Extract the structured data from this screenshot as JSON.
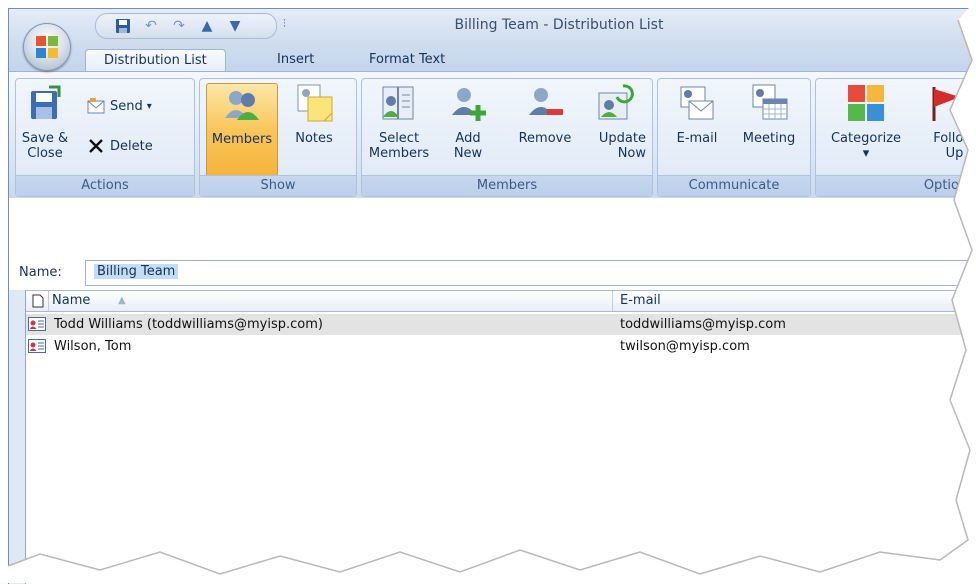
{
  "window": {
    "title": "Billing Team - Distribution List"
  },
  "quick_access": {
    "buttons": [
      "save-icon",
      "undo-icon",
      "redo-icon",
      "previous-item-icon",
      "next-item-icon"
    ],
    "more_symbol": "⫶"
  },
  "tabs": [
    {
      "label": "Distribution List",
      "active": true
    },
    {
      "label": "Insert",
      "active": false
    },
    {
      "label": "Format Text",
      "active": false
    }
  ],
  "ribbon": {
    "actions": {
      "group_label": "Actions",
      "save_close": "Save &\nClose",
      "send": "Send",
      "send_arrow": "▾",
      "delete": "Delete"
    },
    "show": {
      "group_label": "Show",
      "members": "Members",
      "notes": "Notes"
    },
    "members": {
      "group_label": "Members",
      "select_members": "Select\nMembers",
      "add_new": "Add\nNew",
      "remove": "Remove",
      "update_now": "Update\nNow"
    },
    "communicate": {
      "group_label": "Communicate",
      "email": "E-mail",
      "meeting": "Meeting"
    },
    "options": {
      "group_label": "Options",
      "categorize": "Categorize\n▾",
      "follow_up": "Follow\nUp ▾"
    }
  },
  "name_field": {
    "label": "Name:",
    "value": "Billing Team"
  },
  "list": {
    "columns": [
      {
        "label": "Name",
        "sort": "▲"
      },
      {
        "label": "E-mail"
      }
    ],
    "rows": [
      {
        "name": "Todd Williams (toddwilliams@myisp.com)",
        "email": "toddwilliams@myisp.com",
        "selected": true
      },
      {
        "name": "Wilson, Tom",
        "email": "twilson@myisp.com",
        "selected": false
      }
    ]
  },
  "colors": {
    "accent": "#f9c65a",
    "ribbon": "#dde8f6",
    "selection": "#c5dcf7"
  }
}
